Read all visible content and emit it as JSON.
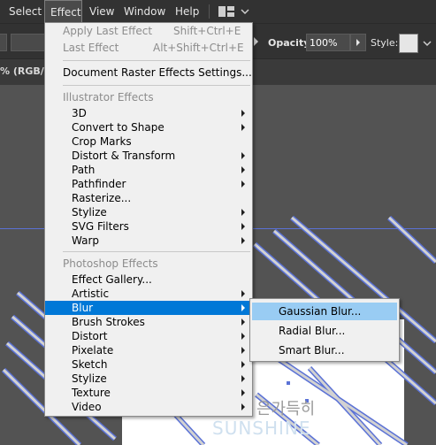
{
  "menubar": {
    "items": [
      {
        "label": "Select"
      },
      {
        "label": "Effect",
        "active": true
      },
      {
        "label": "View"
      },
      {
        "label": "Window"
      },
      {
        "label": "Help"
      }
    ]
  },
  "controlbar": {
    "opacity_label": "Opacity:",
    "opacity_value": "100%",
    "style_label": "Style:"
  },
  "document_tab": {
    "label": "% (RGB/GI"
  },
  "artwork_text": {
    "korean": "은가득히",
    "english": "SUNSHINE"
  },
  "effect_menu": {
    "apply_last_effect": {
      "label": "Apply Last Effect",
      "shortcut": "Shift+Ctrl+E"
    },
    "last_effect": {
      "label": "Last Effect",
      "shortcut": "Alt+Shift+Ctrl+E"
    },
    "document_raster": {
      "label": "Document Raster Effects Settings..."
    },
    "illustrator_header": "Illustrator Effects",
    "illustrator_items": [
      {
        "label": "3D",
        "submenu": true
      },
      {
        "label": "Convert to Shape",
        "submenu": true
      },
      {
        "label": "Crop Marks",
        "submenu": false
      },
      {
        "label": "Distort & Transform",
        "submenu": true
      },
      {
        "label": "Path",
        "submenu": true
      },
      {
        "label": "Pathfinder",
        "submenu": true
      },
      {
        "label": "Rasterize...",
        "submenu": false
      },
      {
        "label": "Stylize",
        "submenu": true
      },
      {
        "label": "SVG Filters",
        "submenu": true
      },
      {
        "label": "Warp",
        "submenu": true
      }
    ],
    "photoshop_header": "Photoshop Effects",
    "photoshop_items": [
      {
        "label": "Effect Gallery...",
        "submenu": false
      },
      {
        "label": "Artistic",
        "submenu": true
      },
      {
        "label": "Blur",
        "submenu": true,
        "highlighted": true
      },
      {
        "label": "Brush Strokes",
        "submenu": true
      },
      {
        "label": "Distort",
        "submenu": true
      },
      {
        "label": "Pixelate",
        "submenu": true
      },
      {
        "label": "Sketch",
        "submenu": true
      },
      {
        "label": "Stylize",
        "submenu": true
      },
      {
        "label": "Texture",
        "submenu": true
      },
      {
        "label": "Video",
        "submenu": true
      }
    ]
  },
  "blur_submenu": {
    "items": [
      {
        "label": "Gaussian Blur...",
        "highlighted": true
      },
      {
        "label": "Radial Blur..."
      },
      {
        "label": "Smart Blur..."
      }
    ]
  },
  "colors": {
    "highlight": "#0078d7",
    "submenu_hover": "#99ccf3",
    "guide": "#5b72d6"
  }
}
